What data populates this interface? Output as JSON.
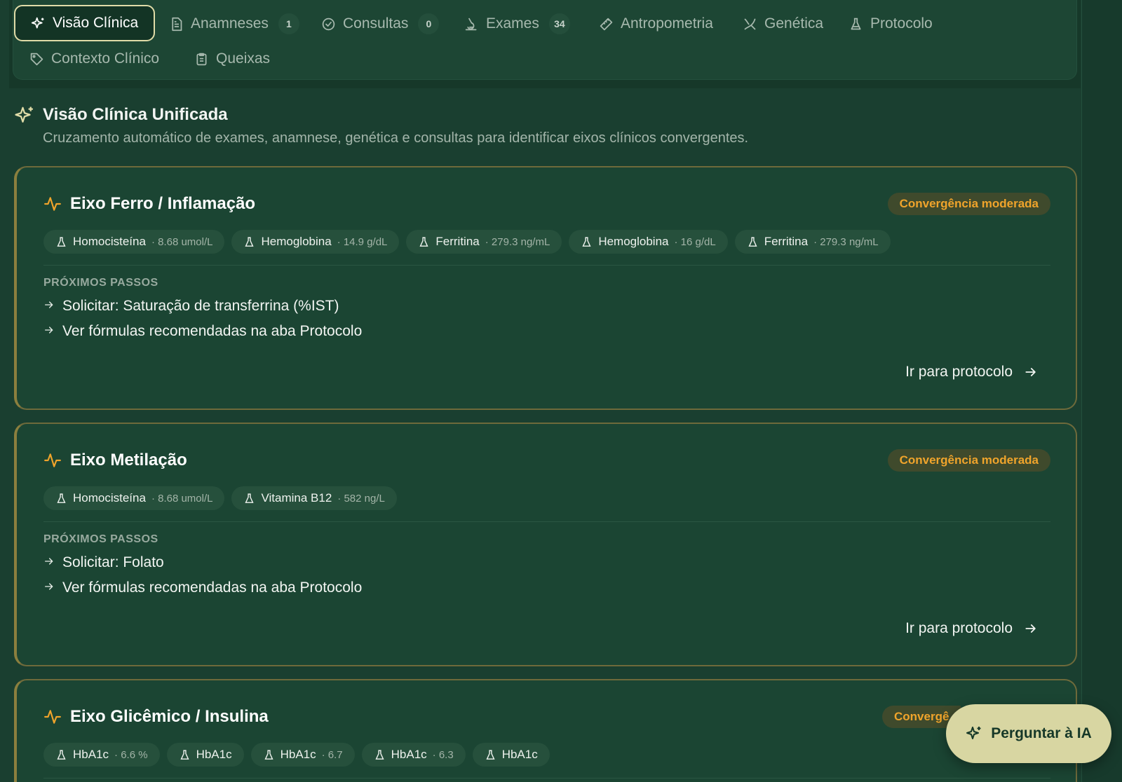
{
  "tabs": [
    {
      "label": "Visão Clínica",
      "icon": "sparkles-icon",
      "active": true
    },
    {
      "label": "Anamneses",
      "icon": "document-icon",
      "count": "1"
    },
    {
      "label": "Consultas",
      "icon": "check-circle-icon",
      "count": "0"
    },
    {
      "label": "Exames",
      "icon": "microscope-icon",
      "count": "34"
    },
    {
      "label": "Antropometria",
      "icon": "ruler-icon"
    },
    {
      "label": "Genética",
      "icon": "dna-icon"
    },
    {
      "label": "Protocolo",
      "icon": "flask-icon"
    },
    {
      "label": "Contexto Clínico",
      "icon": "tag-icon"
    },
    {
      "label": "Queixas",
      "icon": "clipboard-icon"
    }
  ],
  "section": {
    "title": "Visão Clínica Unificada",
    "subtitle": "Cruzamento automático de exames, anamnese, genética e consultas para identificar eixos clínicos convergentes."
  },
  "cards": [
    {
      "title": "Eixo Ferro / Inflamação",
      "badge": "Convergência moderada",
      "chips": [
        {
          "name": "Homocisteína",
          "value": "· 8.68 umol/L"
        },
        {
          "name": "Hemoglobina",
          "value": "· 14.9 g/dL"
        },
        {
          "name": "Ferritina",
          "value": "· 279.3 ng/mL"
        },
        {
          "name": "Hemoglobina",
          "value": "· 16 g/dL"
        },
        {
          "name": "Ferritina",
          "value": "· 279.3 ng/mL"
        }
      ],
      "steps_label": "PRÓXIMOS PASSOS",
      "steps": [
        "Solicitar: Saturação de transferrina (%IST)",
        "Ver fórmulas recomendadas na aba Protocolo"
      ],
      "link": "Ir para protocolo"
    },
    {
      "title": "Eixo Metilação",
      "badge": "Convergência moderada",
      "chips": [
        {
          "name": "Homocisteína",
          "value": "· 8.68 umol/L"
        },
        {
          "name": "Vitamina B12",
          "value": "· 582 ng/L"
        }
      ],
      "steps_label": "PRÓXIMOS PASSOS",
      "steps": [
        "Solicitar: Folato",
        "Ver fórmulas recomendadas na aba Protocolo"
      ],
      "link": "Ir para protocolo"
    },
    {
      "title": "Eixo Glicêmico / Insulina",
      "badge": "Convergê",
      "chips": [
        {
          "name": "HbA1c",
          "value": "· 6.6 %"
        },
        {
          "name": "HbA1c",
          "value": ""
        },
        {
          "name": "HbA1c",
          "value": "· 6.7"
        },
        {
          "name": "HbA1c",
          "value": "· 6.3"
        },
        {
          "name": "HbA1c",
          "value": ""
        }
      ]
    }
  ],
  "fab": {
    "label": "Perguntar à IA",
    "icon": "sparkles-icon"
  },
  "colors": {
    "background": "#1a3f30",
    "accent": "#e0dca8",
    "badge": "#f0a42b",
    "card_border": "#8b7f3e"
  }
}
